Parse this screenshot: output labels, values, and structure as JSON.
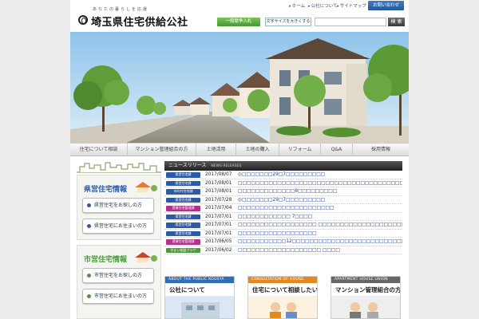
{
  "utility": {
    "home": "ホーム",
    "about": "公社について",
    "sitemap": "サイトマップ",
    "contact": "お問い合わせ"
  },
  "logo": {
    "tagline": "あなたの暮らしを応援",
    "name": "埼玉県住宅供給公社"
  },
  "toolbar": {
    "bid_label": "一般競争入札",
    "font_size_label": "文字サイズを大きくする",
    "search_placeholder": "",
    "search_button": "検 索"
  },
  "gnav": [
    {
      "label": "住宅について相談"
    },
    {
      "label": "マンション管理組合の方"
    },
    {
      "label": "土地活用"
    },
    {
      "label": "土地の購入"
    },
    {
      "label": "リフォーム"
    },
    {
      "label": "Q&A"
    },
    {
      "label": "採用情報"
    }
  ],
  "sidebar": {
    "pref": {
      "title": "県営住宅情報",
      "search_label": "県営住宅をお探しの方",
      "resident_label": "県営住宅にお住まいの方"
    },
    "city": {
      "title": "市営住宅情報",
      "search_label": "市営住宅をお探しの方",
      "resident_label": "市営住宅にお住まいの方"
    }
  },
  "news": {
    "title": "ニュースリリース",
    "subtitle": "NEWS RELEASES",
    "items": [
      {
        "badge": "県営住宅課",
        "badge_color": "#2b5aa8",
        "date": "2017/08/07",
        "text": "◎□□□□□□□29□7□□□□□□□□□"
      },
      {
        "badge": "県営住宅課",
        "badge_color": "#2b5aa8",
        "date": "2017/08/01",
        "text": "□□□□□□□□□□□□□□□□□□□□□□□□□□□□□□□□□□□□□□□□□□"
      },
      {
        "badge": "市町村住宅課",
        "badge_color": "#2b5aa8",
        "date": "2017/08/01",
        "text": "□□□□□□□□□□□□□8□□□□□□□□□"
      },
      {
        "badge": "県営住宅課",
        "badge_color": "#2b5aa8",
        "date": "2017/07/28",
        "text": "◎□□□□□□□29□7□□□□□□□□□"
      },
      {
        "badge": "賃貸住宅管理課",
        "badge_color": "#b0328c",
        "date": "2017/07/04",
        "text": "□□□□□□□□□□□□□□□□□□□□□□"
      },
      {
        "badge": "県営住宅課",
        "badge_color": "#2b5aa8",
        "date": "2017/07/01",
        "text": "□□□□□□□□□□□□ 7□□□□"
      },
      {
        "badge": "県営住宅課",
        "badge_color": "#2b5aa8",
        "date": "2017/07/01",
        "text": "□□□□□□□□□□□□□□□□□□ □□□□□□□□□□□□□□□□□□□□□□□□□□□□□□"
      },
      {
        "badge": "県営住宅課",
        "badge_color": "#2b5aa8",
        "date": "2017/07/01",
        "text": "□□□□□□□□□□□□□□□□□□"
      },
      {
        "badge": "賃貸住宅管理課",
        "badge_color": "#b0328c",
        "date": "2017/06/05",
        "text": "□□□□□□□□□□□12□□□□□□□□□□□□□□□□□□□□□□□□□□ □□□□ □□□□□□□□□□□□□"
      },
      {
        "badge": "住まい相談プラザ",
        "badge_color": "#4a9a3a",
        "date": "2017/06/02",
        "text": "□□□□□□□□□□□□□□□□□□□ □□□□"
      }
    ]
  },
  "boxes": [
    {
      "head": "ABOUT THE PUBLIC KOUSYA",
      "title": "公社について",
      "color": "#2f6fb5"
    },
    {
      "head": "CONSULTATION OF HOUSE",
      "title": "住宅について相談したい",
      "color": "#e28a1f"
    },
    {
      "head": "APARTMENT HOUSE UNION",
      "title": "マンション管理組合の方",
      "color": "#666666"
    }
  ]
}
